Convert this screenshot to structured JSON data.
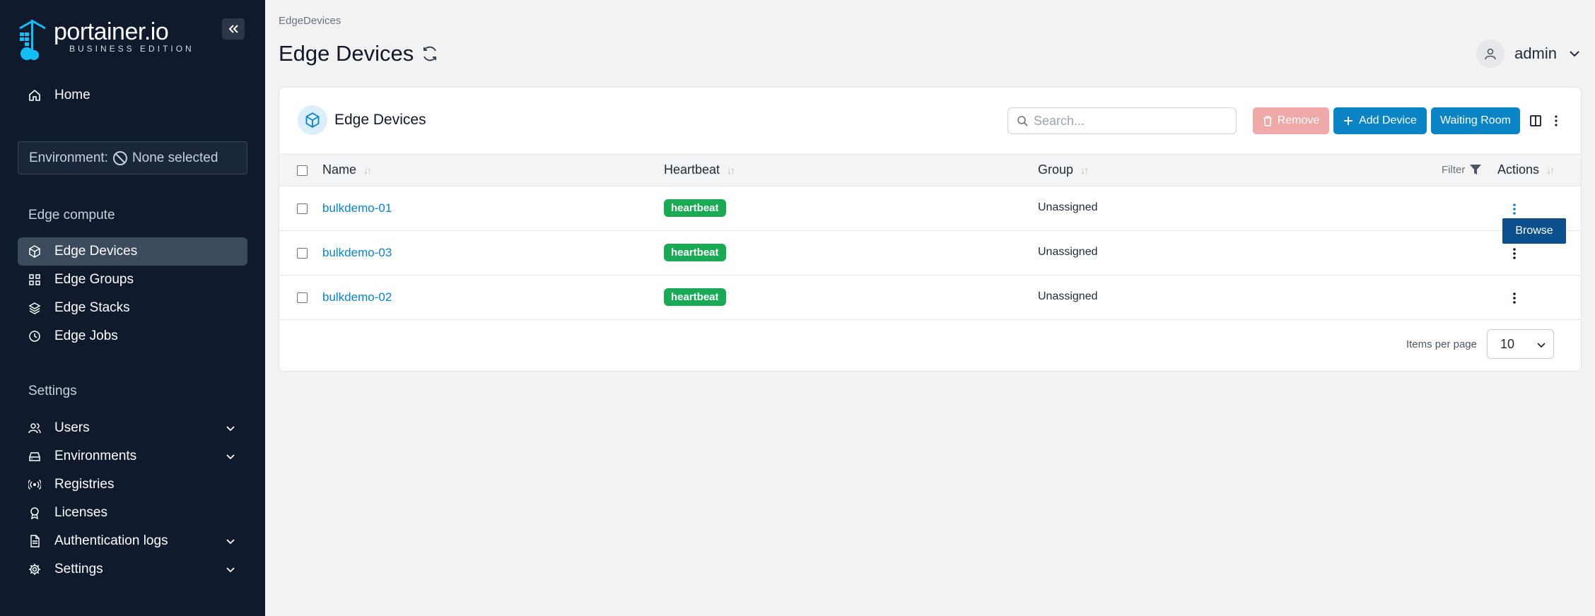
{
  "brand": {
    "name": "portainer.io",
    "edition": "BUSINESS EDITION"
  },
  "sidebar": {
    "home": "Home",
    "environment_prefix": "Environment:",
    "environment_value": "None selected",
    "edge_section": "Edge compute",
    "edge_items": [
      {
        "label": "Edge Devices",
        "icon": "box-icon",
        "active": true
      },
      {
        "label": "Edge Groups",
        "icon": "grid-icon"
      },
      {
        "label": "Edge Stacks",
        "icon": "layers-icon"
      },
      {
        "label": "Edge Jobs",
        "icon": "clock-icon"
      }
    ],
    "settings_section": "Settings",
    "settings_items": [
      {
        "label": "Users",
        "icon": "users-icon",
        "expandable": true
      },
      {
        "label": "Environments",
        "icon": "hdd-icon",
        "expandable": true
      },
      {
        "label": "Registries",
        "icon": "radio-icon"
      },
      {
        "label": "Licenses",
        "icon": "award-icon"
      },
      {
        "label": "Authentication logs",
        "icon": "file-icon",
        "expandable": true
      },
      {
        "label": "Settings",
        "icon": "gear-icon",
        "expandable": true
      }
    ]
  },
  "header": {
    "breadcrumb": "EdgeDevices",
    "title": "Edge Devices",
    "user": "admin"
  },
  "panel": {
    "title": "Edge Devices",
    "search_placeholder": "Search...",
    "buttons": {
      "remove": "Remove",
      "add": "Add Device",
      "waiting": "Waiting Room"
    },
    "columns": {
      "name": "Name",
      "heartbeat": "Heartbeat",
      "group": "Group",
      "filter": "Filter",
      "actions": "Actions"
    },
    "rows": [
      {
        "name": "bulkdemo-01",
        "heartbeat": "heartbeat",
        "group": "Unassigned"
      },
      {
        "name": "bulkdemo-03",
        "heartbeat": "heartbeat",
        "group": "Unassigned"
      },
      {
        "name": "bulkdemo-02",
        "heartbeat": "heartbeat",
        "group": "Unassigned"
      }
    ],
    "popover": "Browse",
    "pager": {
      "label": "Items per page",
      "value": "10"
    }
  },
  "colors": {
    "sidebar": "#0f1b2d",
    "accent": "#0b84c6",
    "success": "#1aaa55",
    "danger_light": "#f0a9a9"
  }
}
